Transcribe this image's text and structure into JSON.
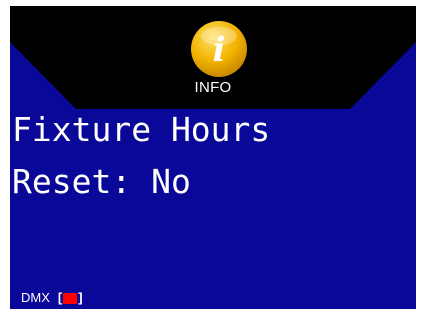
{
  "header": {
    "icon": "info-icon",
    "icon_glyph": "i",
    "label": "INFO"
  },
  "main": {
    "line1": "Fixture Hours",
    "line2": "Reset: No"
  },
  "status": {
    "dmx_label": "DMX",
    "bracket_open": "[",
    "bracket_close": "]",
    "dmx_indicator_color": "#ff0000"
  },
  "colors": {
    "screen_background": "#0a0898",
    "header_background": "#000000",
    "icon_fill": "#f2b300",
    "text": "#ffffff"
  }
}
